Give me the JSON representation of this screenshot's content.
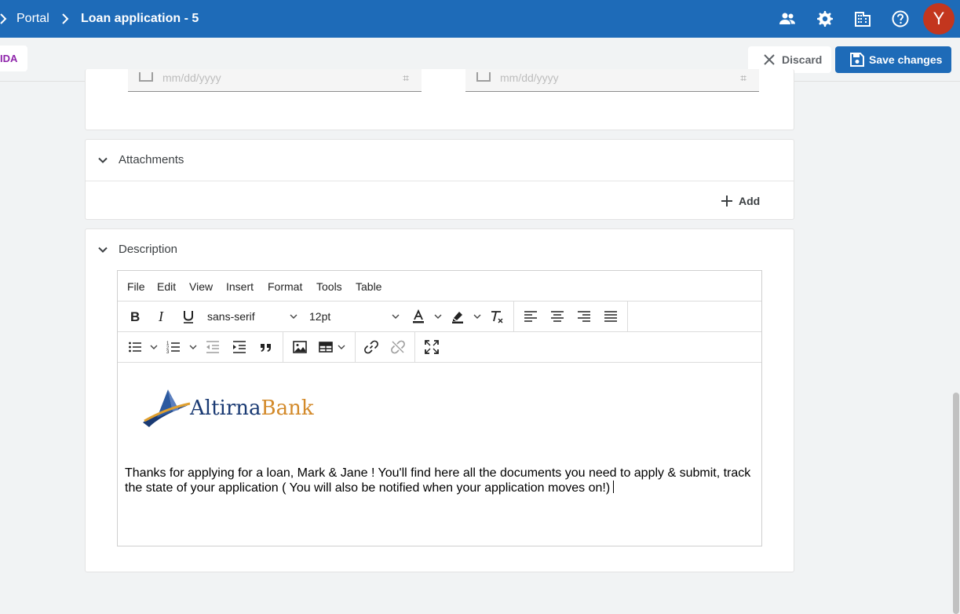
{
  "topbar": {
    "breadcrumb_portal": "Portal",
    "breadcrumb_current": "Loan application - 5",
    "avatar_initial": "Y",
    "accent": "#1e6bb8",
    "avatar_color": "#c3361e",
    "icons": [
      "people-icon",
      "gear-icon",
      "building-icon",
      "help-icon"
    ]
  },
  "actionbar": {
    "chip_label": "IDA",
    "discard_label": "Discard",
    "save_label": "Save changes"
  },
  "dates": {
    "placeholder_1": "mm/dd/yyyy",
    "placeholder_2": "mm/dd/yyyy"
  },
  "attachments": {
    "title": "Attachments",
    "add_label": "Add"
  },
  "description": {
    "title": "Description",
    "menu": [
      "File",
      "Edit",
      "View",
      "Insert",
      "Format",
      "Tools",
      "Table"
    ],
    "font_family": "sans-serif",
    "font_size": "12pt",
    "logo_word_1": "Altirna",
    "logo_word_2": "Bank",
    "body_line": "Thanks for applying for a loan, Mark & Jane !  You'll find here all the documents you need to apply & submit, track the state of your application ( You will also be notified when your application moves on!)"
  }
}
